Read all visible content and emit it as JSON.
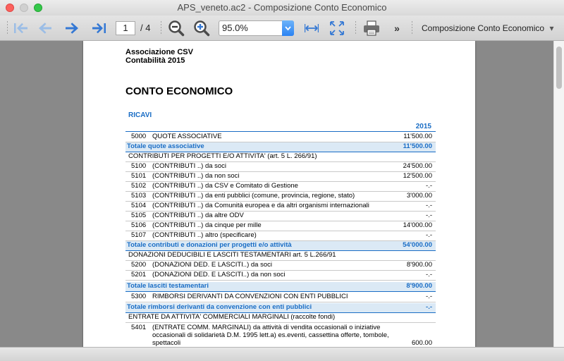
{
  "window": {
    "title": "APS_veneto.ac2 - Composizione Conto Economico"
  },
  "toolbar": {
    "page_current": "1",
    "page_total": "/ 4",
    "zoom": "95.0%",
    "report_name": "Composizione Conto Economico",
    "more": "»",
    "report_arrow": "▾"
  },
  "icons": {
    "first": "arrow-first-icon",
    "prev": "arrow-left-icon",
    "next": "arrow-right-icon",
    "last": "arrow-last-icon",
    "zoom_out": "zoom-out-icon",
    "zoom_in": "zoom-in-icon",
    "fit_width": "fit-width-icon",
    "fit_page": "fit-page-icon",
    "print": "printer-icon"
  },
  "report": {
    "org": "Associazione CSV",
    "subtitle": "Contabilità 2015",
    "heading": "CONTO ECONOMICO",
    "section": "RICAVI",
    "year": "2015",
    "rows": [
      {
        "code": "5000",
        "desc": "QUOTE ASSOCIATIVE",
        "amount": "11'500.00"
      },
      {
        "desc": "Totale quote associative",
        "amount": "11'500.00"
      },
      {
        "desc": "CONTRIBUTI PER PROGETTI E/O ATTIVITA'  (art. 5 L. 266/91)",
        "amount": ""
      },
      {
        "code": "5100",
        "desc": "(CONTRIBUTI ..) da soci",
        "amount": "24'500.00"
      },
      {
        "code": "5101",
        "desc": "(CONTRIBUTI ..) da non soci",
        "amount": "12'500.00"
      },
      {
        "code": "5102",
        "desc": "(CONTRIBUTI ..)  da CSV e Comitato di Gestione",
        "amount": "-.-"
      },
      {
        "code": "5103",
        "desc": "(CONTRIBUTI ..)  da enti pubblici (comune, provincia, regione, stato)",
        "amount": "3'000.00"
      },
      {
        "code": "5104",
        "desc": "(CONTRIBUTI ..)  da Comunità europea e da altri organismi internazionali",
        "amount": "-.-"
      },
      {
        "code": "5105",
        "desc": "(CONTRIBUTI ..) da altre ODV",
        "amount": "-.-"
      },
      {
        "code": "5106",
        "desc": "(CONTRIBUTI ..) da cinque per mille",
        "amount": "14'000.00"
      },
      {
        "code": "5107",
        "desc": "(CONTRIBUTI ..)  altro (specificare)",
        "amount": "-.-"
      },
      {
        "desc": "Totale contributi e donazioni per progetti e/o attività",
        "amount": "54'000.00"
      },
      {
        "desc": "DONAZIONI DEDUCIBILI E LASCITI TESTAMENTARI art. 5 L.266/91",
        "amount": ""
      },
      {
        "code": "5200",
        "desc": "(DONAZIONI DED. E LASCITI..) da soci",
        "amount": "8'900.00"
      },
      {
        "code": "5201",
        "desc": "(DONAZIONI DED. E LASCITI..) da non soci",
        "amount": "-.-"
      },
      {
        "desc": "Totale lasciti testamentari",
        "amount": "8'900.00"
      },
      {
        "code": "5300",
        "desc": "RIMBORSI DERIVANTI DA CONVENZIONI CON ENTI PUBBLICI",
        "amount": "-.-"
      },
      {
        "desc": "Totale rimborsi derivanti da convenzione con enti pubblici",
        "amount": "-.-"
      },
      {
        "desc": "ENTRATE DA ATTIVITA' COMMERCIALI MARGINALI (raccolte fondi)",
        "amount": ""
      },
      {
        "code": "5401",
        "desc": "(ENTRATE COMM. MARGINALI) da attività di vendita occasionali o iniziative occasionali di solidarietà D.M. 1995 lett.a) es.eventi, cassettina offerte, tombole, spettacoli",
        "amount": "600.00"
      }
    ]
  }
}
